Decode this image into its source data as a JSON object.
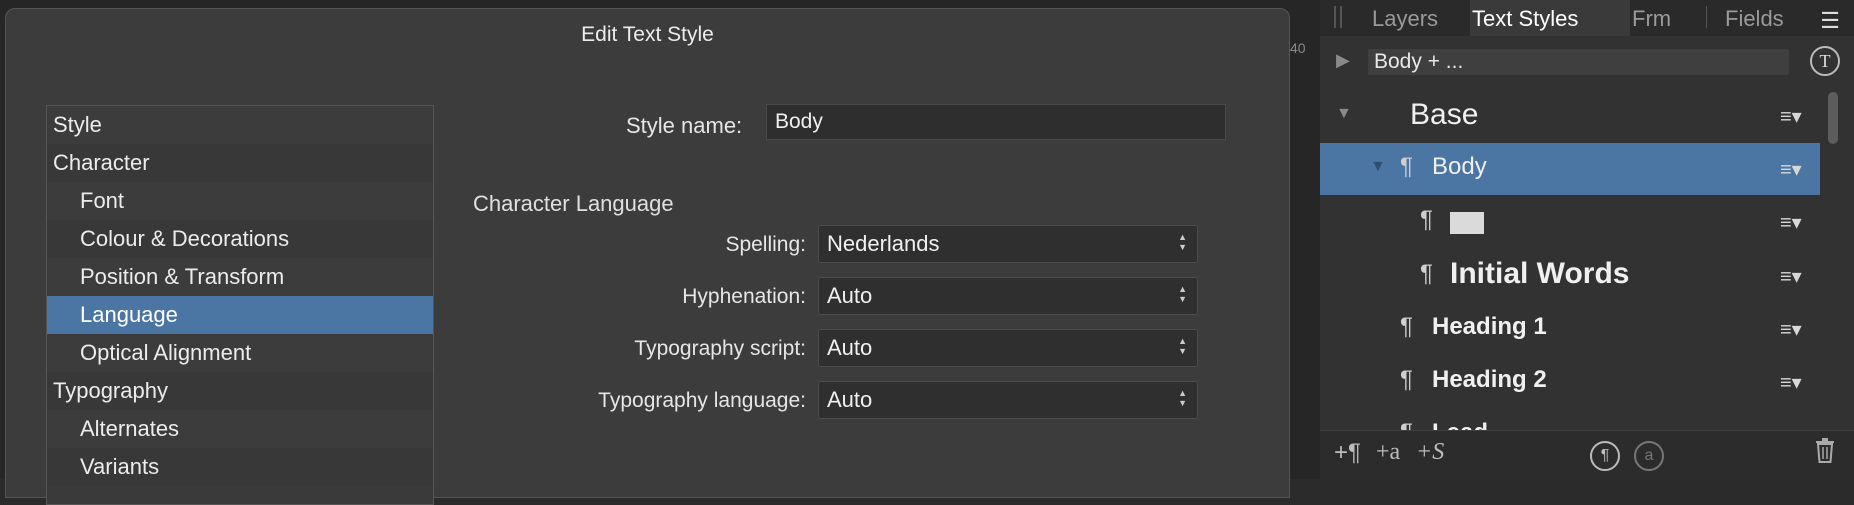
{
  "dialog": {
    "title": "Edit Text Style",
    "categories": [
      {
        "label": "Style",
        "indent": false
      },
      {
        "label": "Character",
        "indent": false
      },
      {
        "label": "Font",
        "indent": true
      },
      {
        "label": "Colour & Decorations",
        "indent": true
      },
      {
        "label": "Position & Transform",
        "indent": true
      },
      {
        "label": "Language",
        "indent": true,
        "selected": true
      },
      {
        "label": "Optical Alignment",
        "indent": true
      },
      {
        "label": "Typography",
        "indent": false
      },
      {
        "label": "Alternates",
        "indent": true
      },
      {
        "label": "Variants",
        "indent": true
      }
    ],
    "style_name_label": "Style name:",
    "style_name_value": "Body",
    "section_heading": "Character Language",
    "fields": [
      {
        "label": "Spelling:",
        "value": "Nederlands"
      },
      {
        "label": "Hyphenation:",
        "value": "Auto"
      },
      {
        "label": "Typography script:",
        "value": "Auto"
      },
      {
        "label": "Typography language:",
        "value": "Auto"
      }
    ]
  },
  "background": {
    "ruler_text": "40"
  },
  "panel": {
    "tabs": [
      "Layers",
      "Text Styles",
      "Frm",
      "Fields"
    ],
    "active_tab": "Text Styles",
    "search_value": "Body + ...",
    "t_icon": "T",
    "styles": [
      {
        "name": "Base"
      },
      {
        "name": "Body"
      },
      {
        "name": ""
      },
      {
        "name": "Initial Words"
      },
      {
        "name": "Heading 1"
      },
      {
        "name": "Heading 2"
      },
      {
        "name": "Lead"
      }
    ],
    "pilcrow": "¶",
    "menu_glyph": "≡▾",
    "bottom_icons": [
      "+¶",
      "+a",
      "+S",
      "¶",
      "a",
      "trash-icon"
    ]
  },
  "colors": {
    "selection": "#4b75a3",
    "dialog_bg": "#3c3c3c",
    "panel_bg": "#323232"
  }
}
